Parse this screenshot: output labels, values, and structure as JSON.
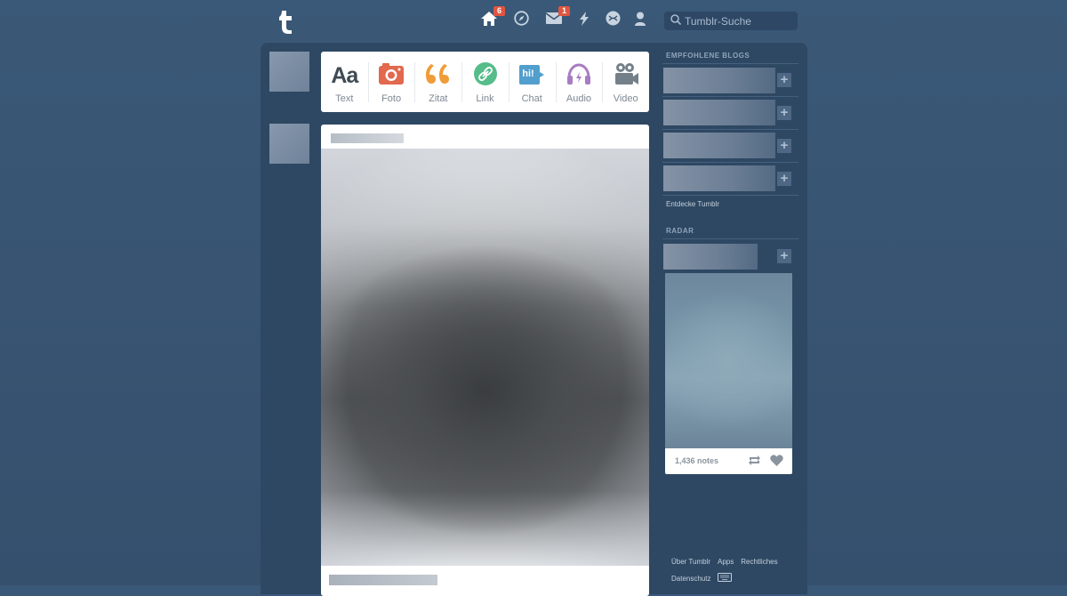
{
  "header": {
    "logo_letter": "t",
    "nav": [
      {
        "icon": "home-icon",
        "badge": "6"
      },
      {
        "icon": "compass-icon",
        "badge": ""
      },
      {
        "icon": "mail-icon",
        "badge": "1"
      },
      {
        "icon": "lightning-icon",
        "badge": ""
      },
      {
        "icon": "video-chat-icon",
        "badge": ""
      },
      {
        "icon": "person-icon",
        "badge": ""
      }
    ],
    "search_placeholder": "Tumblr-Suche"
  },
  "post_types": [
    {
      "label": "Text",
      "icon": "text-icon",
      "glyph": "Aa",
      "color": "#3f4a54"
    },
    {
      "label": "Foto",
      "icon": "camera-icon",
      "color": "#e2684e"
    },
    {
      "label": "Zitat",
      "icon": "quote-icon",
      "color": "#f09c38"
    },
    {
      "label": "Link",
      "icon": "link-icon",
      "color": "#56bc8a"
    },
    {
      "label": "Chat",
      "icon": "chat-icon",
      "glyph": "hi!",
      "color": "#529ecc"
    },
    {
      "label": "Audio",
      "icon": "headphones-icon",
      "color": "#a77dc2"
    },
    {
      "label": "Video",
      "icon": "video-camera-icon",
      "color": "#748089"
    }
  ],
  "sidebar": {
    "recommended_title": "EMPFOHLENE BLOGS",
    "discover_link": "Entdecke Tumblr",
    "radar_title": "RADAR",
    "radar_notes": "1,436 notes"
  },
  "footer": {
    "links": [
      "Über Tumblr",
      "Apps",
      "Rechtliches"
    ],
    "privacy": "Datenschutz"
  },
  "colors": {
    "background": "#35506d",
    "dashboard_panel": "#2e4863",
    "badge": "#e0553f"
  }
}
